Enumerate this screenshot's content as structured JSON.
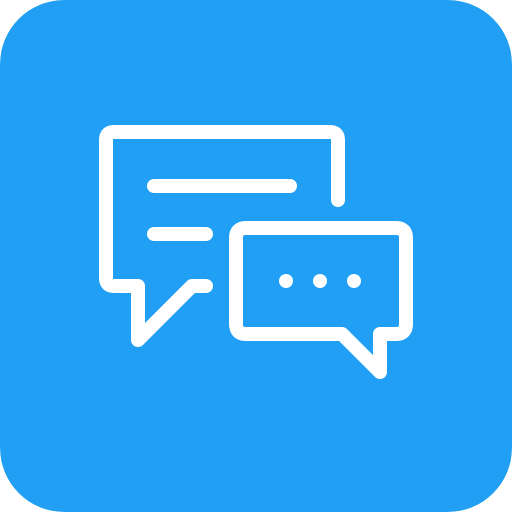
{
  "app_icon": {
    "name": "chat-bubbles-icon",
    "background_color": "#209ff4",
    "stroke_color": "#ffffff"
  }
}
